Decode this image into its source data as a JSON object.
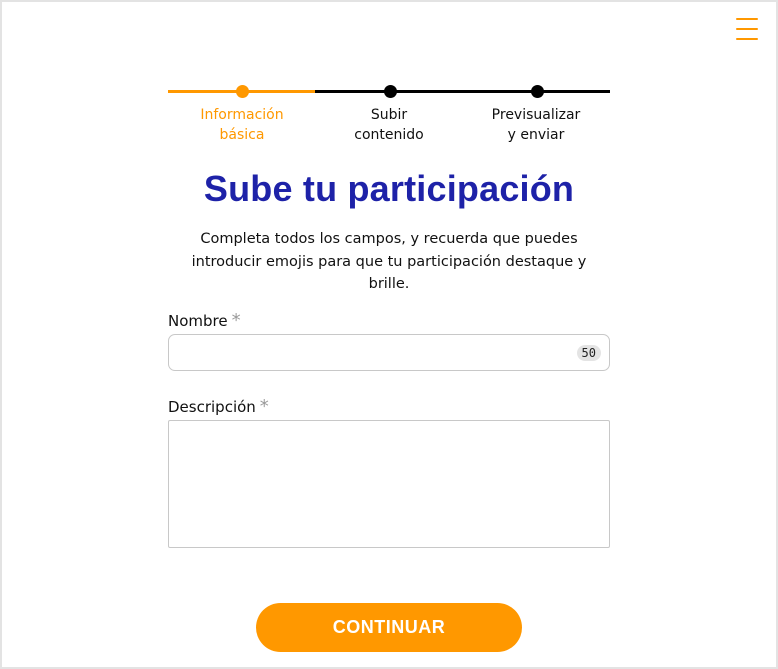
{
  "stepper": {
    "steps": [
      {
        "line1": "Información",
        "line2": "básica",
        "state": "active"
      },
      {
        "line1": "Subir",
        "line2": "contenido",
        "state": "pending"
      },
      {
        "line1": "Previsualizar",
        "line2": "y enviar",
        "state": "pending"
      }
    ]
  },
  "page": {
    "title": "Sube tu participación",
    "subtitle": "Completa todos los campos, y recuerda que puedes introducir emojis para que tu participación destaque y brille."
  },
  "form": {
    "name_label": "Nombre",
    "name_required": "*",
    "name_value": "",
    "name_counter": "50",
    "description_label": "Descripción",
    "description_required": "*",
    "description_value": ""
  },
  "actions": {
    "continue_label": "CONTINUAR"
  },
  "colors": {
    "accent": "#ff9800",
    "title": "#1e22a8",
    "border": "#c8c8c8"
  },
  "icons": {
    "menu": "hamburger-menu-icon"
  }
}
